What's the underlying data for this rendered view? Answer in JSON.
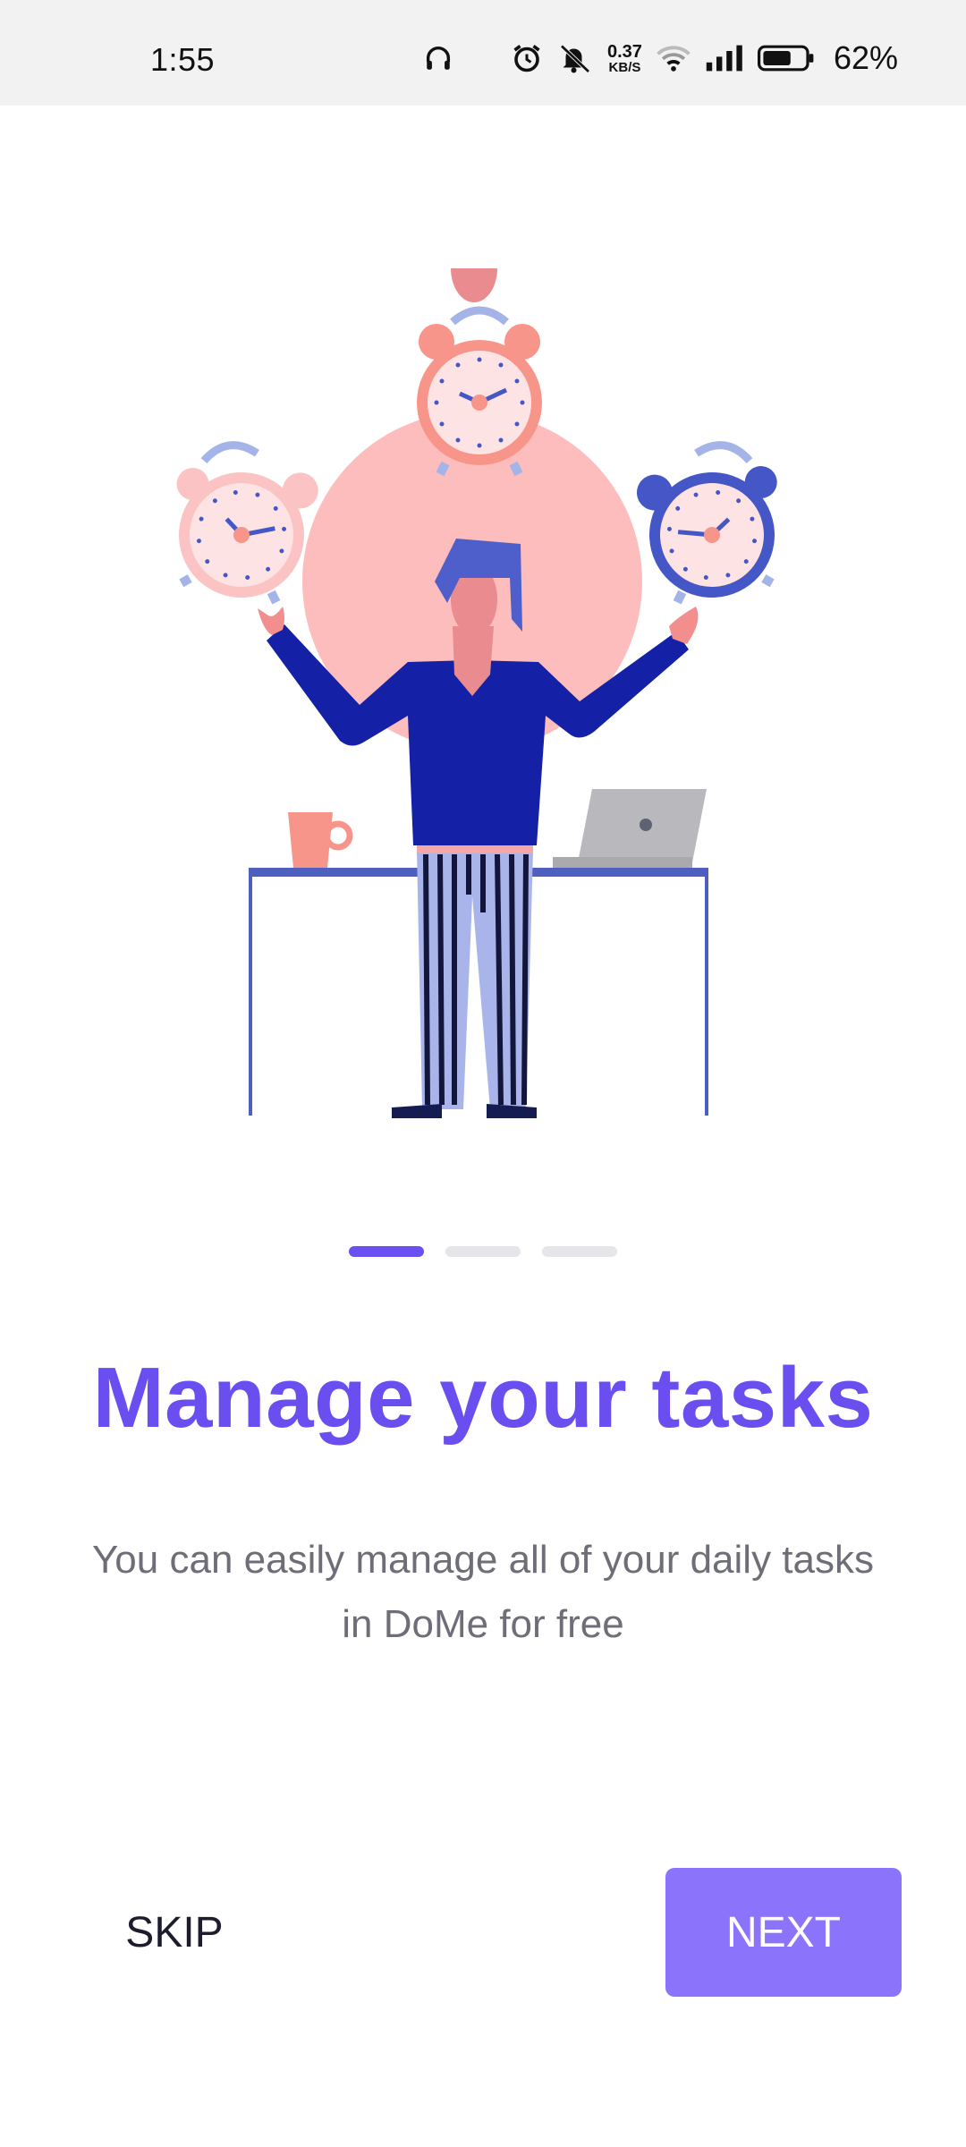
{
  "status_bar": {
    "time": "1:55",
    "net_speed_value": "0.37",
    "net_speed_unit": "KB/S",
    "battery_percent": "62%",
    "icons": [
      "headphones-icon",
      "moon-icon",
      "alarm-icon",
      "mute-icon",
      "wifi-icon",
      "signal-icon",
      "battery-icon"
    ]
  },
  "illustration": {
    "description_icon": "person-juggling-alarm-clocks",
    "colors": {
      "circle": "#fdbdbd",
      "shirt": "#1420a6",
      "clock_pink": "#f88e86",
      "clock_blue": "#4556c7",
      "desk": "#4e5fbf"
    }
  },
  "pager": {
    "count": 3,
    "active_index": 0
  },
  "content": {
    "title": "Manage your tasks",
    "subtitle_line1": "You can easily manage all of your daily tasks",
    "subtitle_line2": "in DoMe for free"
  },
  "actions": {
    "skip_label": "SKIP",
    "next_label": "NEXT"
  },
  "colors": {
    "accent": "#6b4ef0",
    "button": "#8b74fb",
    "pager_active": "#6c4ff2",
    "pager_inactive": "#e6e6ea"
  }
}
